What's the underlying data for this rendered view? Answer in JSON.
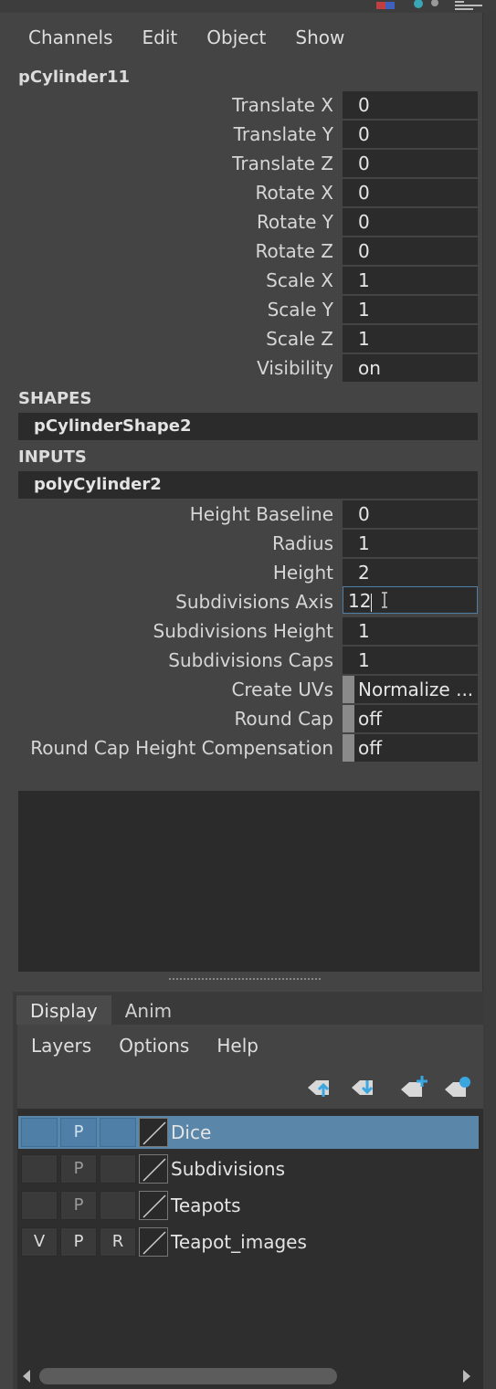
{
  "menubar": [
    "Channels",
    "Edit",
    "Object",
    "Show"
  ],
  "object_name": "pCylinder11",
  "transform_attrs": [
    {
      "label": "Translate X",
      "value": "0"
    },
    {
      "label": "Translate Y",
      "value": "0"
    },
    {
      "label": "Translate Z",
      "value": "0"
    },
    {
      "label": "Rotate X",
      "value": "0"
    },
    {
      "label": "Rotate Y",
      "value": "0"
    },
    {
      "label": "Rotate Z",
      "value": "0"
    },
    {
      "label": "Scale X",
      "value": "1"
    },
    {
      "label": "Scale Y",
      "value": "1"
    },
    {
      "label": "Scale Z",
      "value": "1"
    },
    {
      "label": "Visibility",
      "value": "on"
    }
  ],
  "shapes": {
    "title": "SHAPES",
    "node": "pCylinderShape2"
  },
  "inputs": {
    "title": "INPUTS",
    "node": "polyCylinder2"
  },
  "input_attrs": [
    {
      "label": "Height Baseline",
      "value": "0"
    },
    {
      "label": "Radius",
      "value": "1"
    },
    {
      "label": "Height",
      "value": "2"
    },
    {
      "label": "Subdivisions Axis",
      "value": "12"
    },
    {
      "label": "Subdivisions Height",
      "value": "1"
    },
    {
      "label": "Subdivisions Caps",
      "value": "1"
    },
    {
      "label": "Create UVs",
      "value": "Normalize ..."
    },
    {
      "label": "Round Cap",
      "value": "off"
    },
    {
      "label": "Round Cap Height Compensation",
      "value": "off"
    }
  ],
  "layer_tabs": [
    "Display",
    "Anim"
  ],
  "layer_menu": [
    "Layers",
    "Options",
    "Help"
  ],
  "layers": [
    {
      "v": "",
      "p": "P",
      "r": "",
      "name": "Dice"
    },
    {
      "v": "",
      "p": "P",
      "r": "",
      "name": "Subdivisions"
    },
    {
      "v": "",
      "p": "P",
      "r": "",
      "name": "Teapots"
    },
    {
      "v": "V",
      "p": "P",
      "r": "R",
      "name": "Teapot_images"
    }
  ],
  "colors": {
    "background": "#444444",
    "field": "#2b2b2b",
    "selection": "#5a86aa",
    "active_border": "#4f7fa5"
  },
  "icons": [
    "move-layer-up-icon",
    "move-layer-down-icon",
    "new-layer-icon",
    "new-layer-from-selection-icon",
    "text-cursor-icon",
    "scroll-left-icon",
    "scroll-right-icon"
  ]
}
